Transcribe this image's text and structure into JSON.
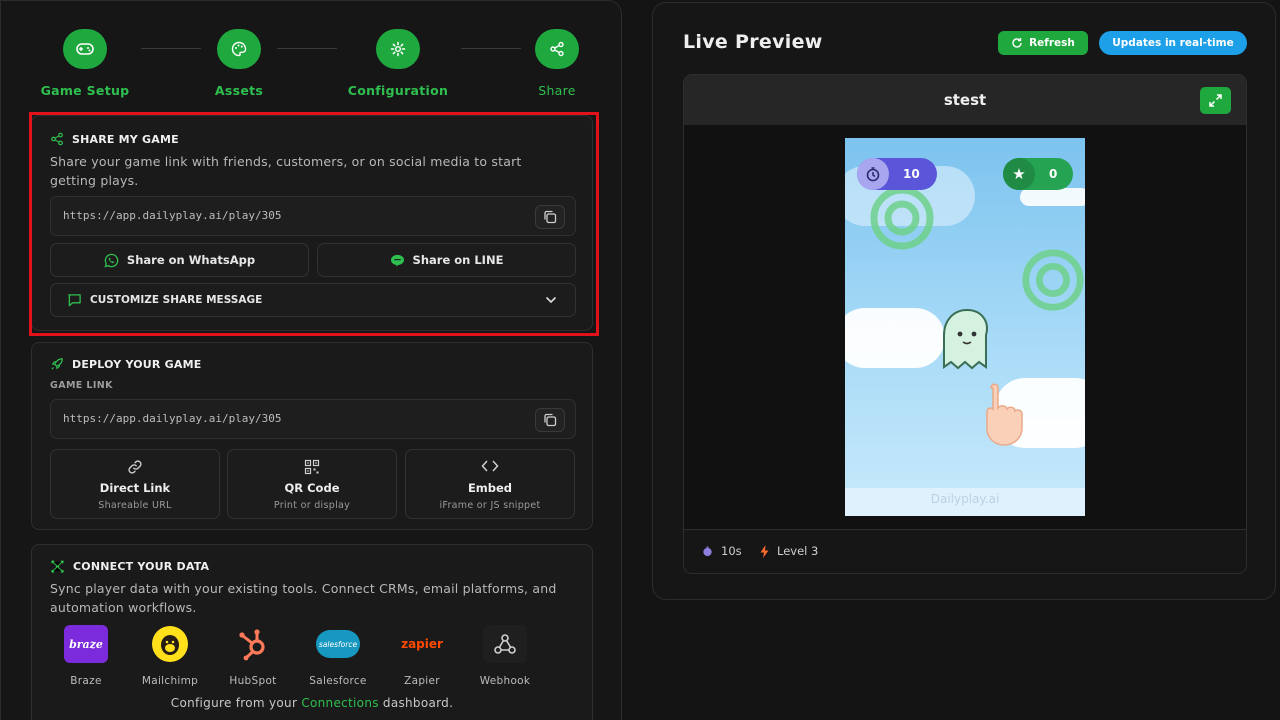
{
  "stepper": {
    "steps": [
      {
        "label": "Game Setup",
        "icon": "gamepad-icon"
      },
      {
        "label": "Assets",
        "icon": "palette-icon"
      },
      {
        "label": "Configuration",
        "icon": "gear-icon"
      },
      {
        "label": "Share",
        "icon": "share-icon"
      }
    ]
  },
  "share_card": {
    "title": "SHARE MY GAME",
    "description": "Share your game link with friends, customers, or on social media to start getting plays.",
    "url": "https://app.dailyplay.ai/play/305",
    "whatsapp_label": "Share on WhatsApp",
    "line_label": "Share on LINE",
    "customize_label": "CUSTOMIZE SHARE MESSAGE"
  },
  "deploy_card": {
    "title": "DEPLOY YOUR GAME",
    "link_label": "GAME LINK",
    "url": "https://app.dailyplay.ai/play/305",
    "options": [
      {
        "title": "Direct Link",
        "subtitle": "Shareable URL"
      },
      {
        "title": "QR Code",
        "subtitle": "Print or display"
      },
      {
        "title": "Embed",
        "subtitle": "iFrame or JS snippet"
      }
    ]
  },
  "connect_card": {
    "title": "CONNECT YOUR DATA",
    "description": "Sync player data with your existing tools. Connect CRMs, email platforms, and automation workflows.",
    "integrations": [
      "Braze",
      "Mailchimp",
      "HubSpot",
      "Salesforce",
      "Zapier",
      "Webhook"
    ],
    "braze_logo_text": "braze",
    "salesforce_logo_text": "salesforce",
    "zapier_logo_text": "zapier",
    "footer_prefix": "Configure from your",
    "footer_link": "Connections",
    "footer_suffix": "dashboard."
  },
  "preview": {
    "title": "Live Preview",
    "refresh_label": "Refresh",
    "realtime_label": "Updates in real-time",
    "game_name": "stest",
    "timer_value": "10",
    "score_value": "0",
    "watermark": "Dailyplay.ai",
    "footer_time": "10s",
    "footer_level": "Level 3"
  },
  "colors": {
    "accent_green": "#1fa83e",
    "blue_pill": "#1ea0e8",
    "highlight_red": "#e0121a"
  }
}
